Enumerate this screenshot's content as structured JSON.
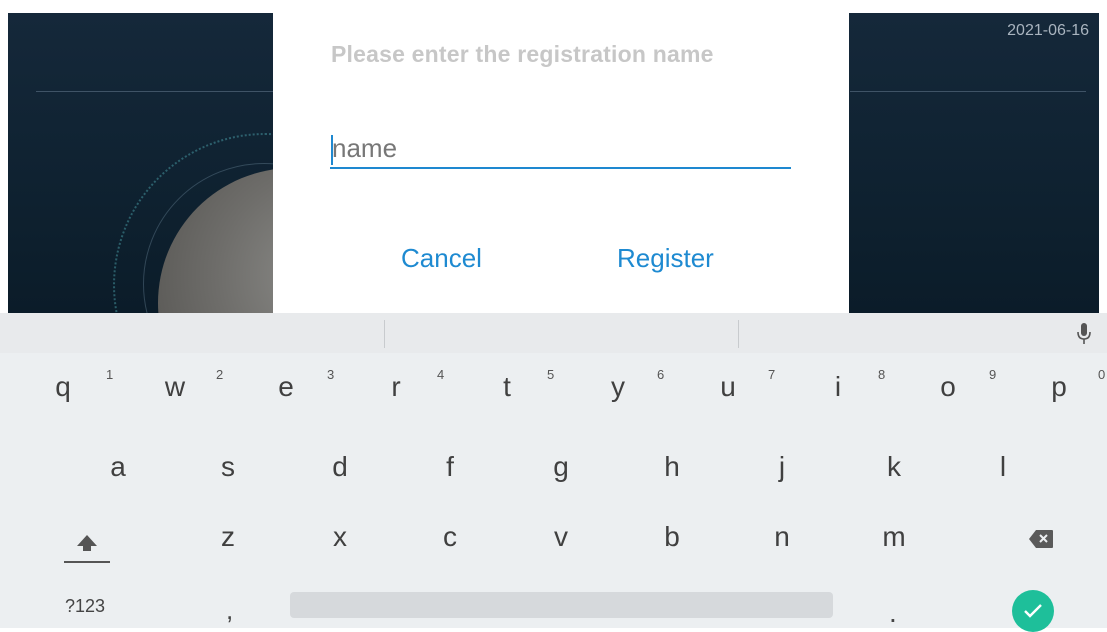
{
  "status": {
    "date": "2021-06-16"
  },
  "dialog": {
    "title": "Please enter the registration name",
    "input_placeholder": "name",
    "input_value": "",
    "cancel_label": "Cancel",
    "register_label": "Register"
  },
  "keyboard": {
    "rows": [
      [
        {
          "key": "q",
          "hint": "1"
        },
        {
          "key": "w",
          "hint": "2"
        },
        {
          "key": "e",
          "hint": "3"
        },
        {
          "key": "r",
          "hint": "4"
        },
        {
          "key": "t",
          "hint": "5"
        },
        {
          "key": "y",
          "hint": "6"
        },
        {
          "key": "u",
          "hint": "7"
        },
        {
          "key": "i",
          "hint": "8"
        },
        {
          "key": "o",
          "hint": "9"
        },
        {
          "key": "p",
          "hint": "0"
        }
      ],
      [
        {
          "key": "a"
        },
        {
          "key": "s"
        },
        {
          "key": "d"
        },
        {
          "key": "f"
        },
        {
          "key": "g"
        },
        {
          "key": "h"
        },
        {
          "key": "j"
        },
        {
          "key": "k"
        },
        {
          "key": "l"
        }
      ],
      [
        {
          "key": "z"
        },
        {
          "key": "x"
        },
        {
          "key": "c"
        },
        {
          "key": "v"
        },
        {
          "key": "b"
        },
        {
          "key": "n"
        },
        {
          "key": "m"
        }
      ]
    ],
    "symbols_label": "?123",
    "comma_label": ",",
    "period_label": ".",
    "colors": {
      "enter": "#1ebf9a",
      "accent": "#1e88d0"
    }
  }
}
